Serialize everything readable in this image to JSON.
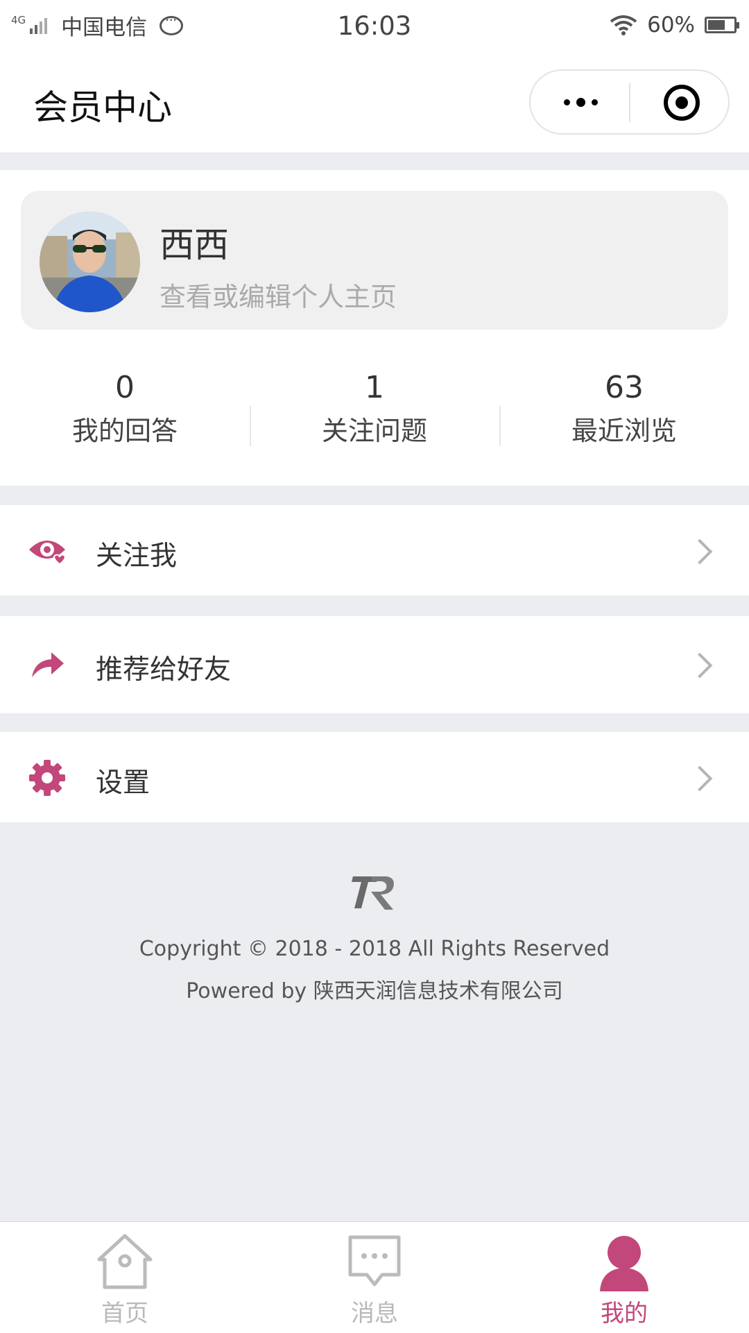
{
  "status_bar": {
    "network": "4G",
    "carrier": "中国电信",
    "time": "16:03",
    "battery": "60%",
    "battery_level": 0.6,
    "icons": [
      "signal-icon",
      "message-icon",
      "wifi-icon",
      "battery-icon"
    ]
  },
  "nav": {
    "title": "会员中心",
    "capsule_icons": [
      "more-icon",
      "close-target-icon"
    ]
  },
  "profile": {
    "name": "西西",
    "subtitle": "查看或编辑个人主页"
  },
  "stats": [
    {
      "value": "0",
      "label": "我的回答"
    },
    {
      "value": "1",
      "label": "关注问题"
    },
    {
      "value": "63",
      "label": "最近浏览"
    }
  ],
  "menu": [
    {
      "label": "关注我",
      "icon": "eye-heart-icon"
    },
    {
      "label": "推荐给好友",
      "icon": "share-icon"
    },
    {
      "label": "设置",
      "icon": "gear-icon"
    }
  ],
  "footer": {
    "copyright": "Copyright © 2018 - 2018 All Rights Reserved",
    "powered": "Powered by 陕西天润信息技术有限公司"
  },
  "tabbar": [
    {
      "label": "首页",
      "icon": "home-icon",
      "active": false
    },
    {
      "label": "消息",
      "icon": "message-icon",
      "active": false
    },
    {
      "label": "我的",
      "icon": "user-icon",
      "active": true
    }
  ],
  "colors": {
    "accent": "#c2477a",
    "background": "#ecedf0",
    "inactive": "#b9b9b9"
  }
}
